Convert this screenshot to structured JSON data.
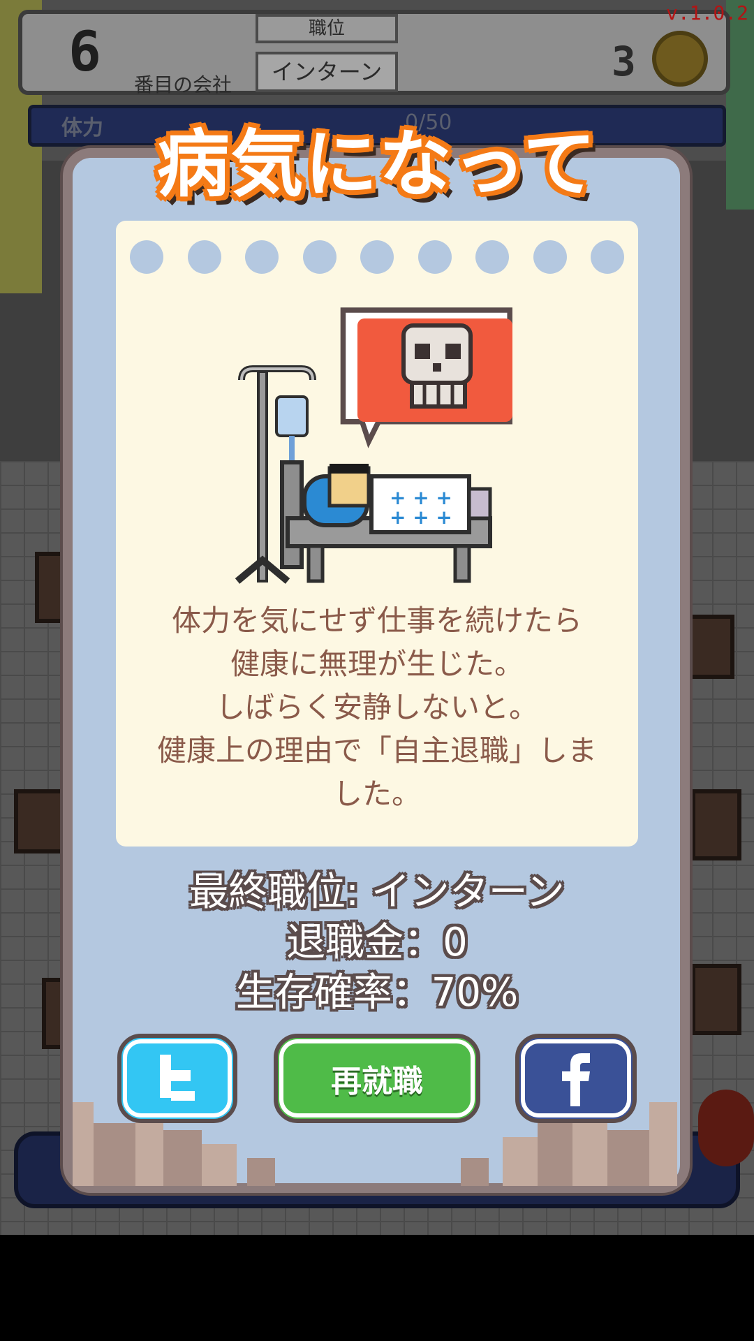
{
  "header": {
    "company_number": "6",
    "company_label": "番目の会社",
    "position_heading": "職位",
    "position_value": "インターン",
    "coins": "3",
    "stamina_label": "体力",
    "stamina_value": "0/50",
    "version": "v.1.0.2"
  },
  "modal": {
    "title": "病気になって",
    "message": "体力を気にせず仕事を続けたら\n健康に無理が生じた。\nしばらく安静しないと。\n健康上の理由で「自主退職」しま\nした。",
    "final_position": "最終職位: インターン",
    "severance": "退職金：0",
    "survival_rate": "生存確率：70%",
    "buttons": {
      "rehire_label": "再就職",
      "twitter_icon": "twitter-icon",
      "facebook_icon": "facebook-icon"
    }
  },
  "icons": {
    "illustration": "sick-in-hospital-bed-illustration",
    "bubble": "skull-speech-bubble-icon",
    "coin": "coin-icon",
    "alert": "exclamation-icon"
  },
  "colors": {
    "title_outline": "#f47a16",
    "modal_bg": "#b4c8e0",
    "notepad_bg": "#fdf8e3",
    "message_text": "#8a5a4a",
    "rehire_button": "#4fbb48",
    "twitter_button": "#33c6f3",
    "facebook_button": "#3a5197"
  }
}
